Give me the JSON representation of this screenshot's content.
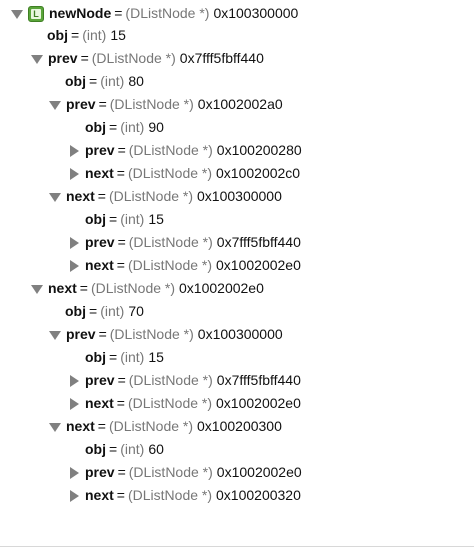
{
  "rows": [
    {
      "name": "newNode",
      "type": "(DListNode *)",
      "value": "0x100300000",
      "badge": "L"
    },
    {
      "name": "obj",
      "type": "(int)",
      "value": "15"
    },
    {
      "name": "prev",
      "type": "(DListNode *)",
      "value": "0x7fff5fbff440"
    },
    {
      "name": "obj",
      "type": "(int)",
      "value": "80"
    },
    {
      "name": "prev",
      "type": "(DListNode *)",
      "value": "0x1002002a0"
    },
    {
      "name": "obj",
      "type": "(int)",
      "value": "90"
    },
    {
      "name": "prev",
      "type": "(DListNode *)",
      "value": "0x100200280"
    },
    {
      "name": "next",
      "type": "(DListNode *)",
      "value": "0x1002002c0"
    },
    {
      "name": "next",
      "type": "(DListNode *)",
      "value": "0x100300000"
    },
    {
      "name": "obj",
      "type": "(int)",
      "value": "15"
    },
    {
      "name": "prev",
      "type": "(DListNode *)",
      "value": "0x7fff5fbff440"
    },
    {
      "name": "next",
      "type": "(DListNode *)",
      "value": "0x1002002e0"
    },
    {
      "name": "next",
      "type": "(DListNode *)",
      "value": "0x1002002e0"
    },
    {
      "name": "obj",
      "type": "(int)",
      "value": "70"
    },
    {
      "name": "prev",
      "type": "(DListNode *)",
      "value": "0x100300000"
    },
    {
      "name": "obj",
      "type": "(int)",
      "value": "15"
    },
    {
      "name": "prev",
      "type": "(DListNode *)",
      "value": "0x7fff5fbff440"
    },
    {
      "name": "next",
      "type": "(DListNode *)",
      "value": "0x1002002e0"
    },
    {
      "name": "next",
      "type": "(DListNode *)",
      "value": "0x100200300"
    },
    {
      "name": "obj",
      "type": "(int)",
      "value": "60"
    },
    {
      "name": "prev",
      "type": "(DListNode *)",
      "value": "0x1002002e0"
    },
    {
      "name": "next",
      "type": "(DListNode *)",
      "value": "0x100200320"
    }
  ]
}
